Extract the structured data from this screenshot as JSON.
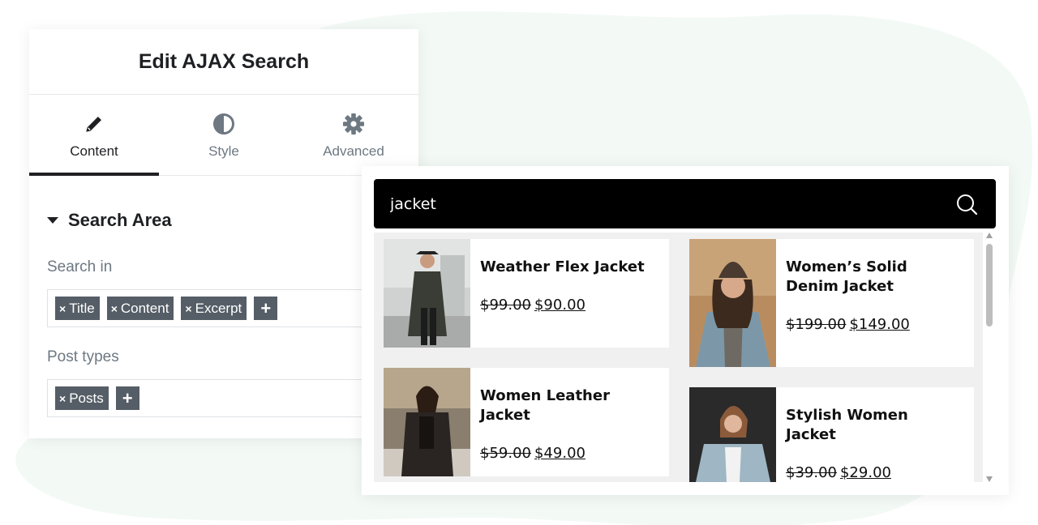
{
  "editor": {
    "title": "Edit AJAX Search",
    "tabs": [
      {
        "label": "Content",
        "icon": "pencil-icon",
        "active": true
      },
      {
        "label": "Style",
        "icon": "half-circle-icon",
        "active": false
      },
      {
        "label": "Advanced",
        "icon": "gear-icon",
        "active": false
      }
    ],
    "section_title": "Search Area",
    "search_in": {
      "label": "Search in",
      "tags": [
        "Title",
        "Content",
        "Excerpt"
      ],
      "remove_glyph": "×",
      "add_glyph": "+"
    },
    "post_types": {
      "label": "Post types",
      "tags": [
        "Posts"
      ],
      "remove_glyph": "×",
      "add_glyph": "+"
    }
  },
  "search": {
    "query": "jacket",
    "icon": "search-icon",
    "results": [
      {
        "name": "Weather Flex Jacket",
        "old_price": "$99.00",
        "new_price": "$90.00"
      },
      {
        "name": "Women’s Solid Denim Jacket",
        "old_price": "$199.00",
        "new_price": "$149.00"
      },
      {
        "name": "Women Leather Jacket",
        "old_price": "$59.00",
        "new_price": "$49.00"
      },
      {
        "name": "Stylish Women Jacket",
        "old_price": "$39.00",
        "new_price": "$29.00"
      }
    ]
  },
  "colors": {
    "accent_dark": "#1f2023",
    "tag_bg": "#555d66",
    "search_bar_bg": "#000000",
    "results_bg": "#f0f0f0",
    "blob": "#f3faf6"
  }
}
